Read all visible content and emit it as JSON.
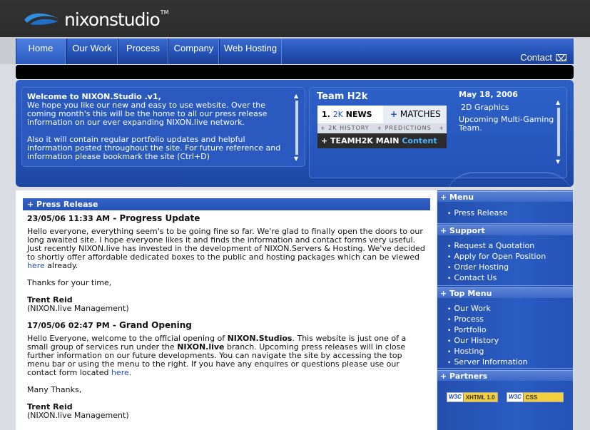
{
  "brand": {
    "name": "nixonstudio",
    "tm": "TM"
  },
  "nav": {
    "items": [
      "Home",
      "Our Work",
      "Process",
      "Company",
      "Web Hosting"
    ],
    "contact": "Contact"
  },
  "welcome": {
    "title": "Welcome to NIXON.Studio .v1,",
    "para1": "We hope you like our new and easy to use website. Over the coming month's this will be the home to all our press release information on our ever expanding NIXON.live network.",
    "para2": "Also it will contain regular portfolio updates and helpful information posted throughout the site. For future reference and information please bookmark the site (Ctrl+D)"
  },
  "team": {
    "title": "Team H2k",
    "news_prefix": "1.",
    "news_num": "2K",
    "news_label": "NEWS",
    "matches_plus": "+",
    "matches_label": "MATCHES",
    "sub_history": "+ 2K HISTORY",
    "sub_predictions": "+ PREDICTIONS",
    "sub_plus": "+",
    "main_prefix": "+ TEAMH2K MAIN",
    "main_suffix": "Content",
    "date": "May 18, 2006",
    "line1": "2D Graphics",
    "line2": "Upcoming Multi-Gaming Team."
  },
  "press": {
    "header": "+ Press Release",
    "post1": {
      "date": "23/05/06 11:33 AM",
      "sep": " - ",
      "title": "Progress Update",
      "body": "Hello everyone, everything seem's to be going fine so far. We're glad to finally open the doors to our long awaited site. I hope everyone likes it and finds the information and contact forms very useful. Just recently NIXON.live has invested in the development of NIXON.Servers & Hosting. We've decided to shortly offer affordable dedicated boxes to the public and hosting packages which can be viewed",
      "link": "here",
      "after": " already.",
      "thanks": "Thanks for your time,",
      "author": "Trent Reid",
      "role": "(NIXON.live Management)"
    },
    "post2": {
      "date": "17/05/06 02:47 PM",
      "sep": " - ",
      "title": "Grand Opening",
      "body_a": "Hello Everyone, welcome to the official opening of ",
      "bold_a": "NIXON.Studios",
      "body_b": ". This website is just one of a small group of services run under the ",
      "bold_b": "NIXON.live",
      "body_c": " branch. Upcoming press releases will in close further information on our future developments. You can navigate the site by accessing the top menu bar or using the menu to the right. If you have any enquires or questions please use our contact form located ",
      "link": "here.",
      "thanks": "Many Thanks,",
      "author": "Trent Reid",
      "role": "(NIXON.live Management)"
    }
  },
  "sidebar": {
    "menu_title": "+ Menu",
    "menu_items": [
      "Press Release"
    ],
    "support_title": "+ Support",
    "support_items": [
      "Request a Quotation",
      "Apply for Open Position",
      "Order Hosting",
      "Contact Us"
    ],
    "top_title": "+ Top Menu",
    "top_items": [
      "Our Work",
      "Process",
      "Portfolio",
      "Our History",
      "Hosting",
      "Server Information"
    ],
    "partners_title": "+ Partners",
    "badges": [
      {
        "w3": "W3C",
        "label": "XHTML 1.0"
      },
      {
        "w3": "W3C",
        "label": "CSS"
      }
    ]
  }
}
